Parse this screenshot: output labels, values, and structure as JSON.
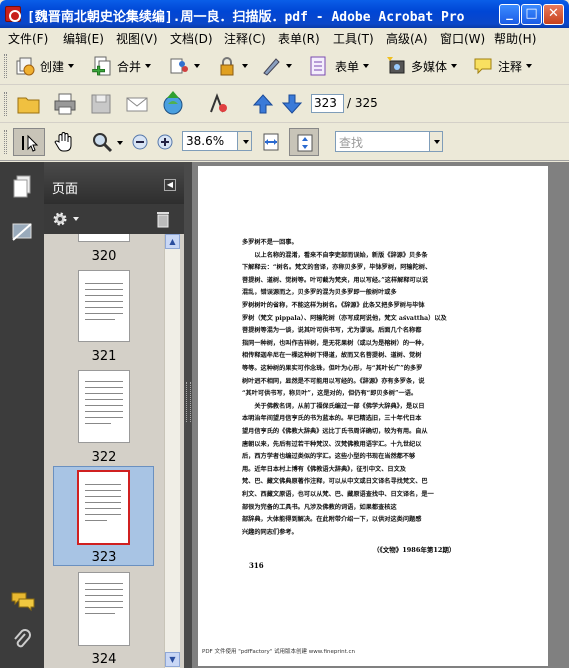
{
  "window": {
    "title": "[魏晋南北朝史论集续编].周一良．扫描版．pdf - Adobe Acrobat Pro",
    "minimize": "_",
    "maximize": "□",
    "close": "✕"
  },
  "menu": [
    "文件(F)",
    "编辑(E)",
    "视图(V)",
    "文档(D)",
    "注释(C)",
    "表单(R)",
    "工具(T)",
    "高级(A)",
    "窗口(W)",
    "帮助(H)"
  ],
  "toolbar1": {
    "create": "创建",
    "combine": "合并",
    "form": "表单",
    "multimedia": "多媒体",
    "comment": "注释"
  },
  "toolbar2": {
    "page_current": "323",
    "page_total": "/ 325"
  },
  "toolbar3": {
    "zoom": "38.6%",
    "search_placeholder": "查找"
  },
  "panel": {
    "title": "页面",
    "thumbnails": [
      "320",
      "321",
      "322",
      "323",
      "324"
    ],
    "selected": "323"
  },
  "document": {
    "lines": [
      "多罗树不是一回事。",
      "　　以上名称的混淆，看来不自李吏部而误始，新版《辞源》贝多条",
      "下解释云：“树名。梵文的音译，亦称贝多罗，毕钵罗树，阿输陀树、",
      "菩提树、道树、觉树等。叶可截为梵夹，用以写经。”这样解释可以说",
      "混乱，错误源而之，贝多罗的混为贝多罗即一般树叶或多",
      "罗树树叶的省称，不能这样为树名。《辞源》此条又把多罗树与毕钵",
      "罗树（梵文 pippala）、阿输陀树（亦写成阿说他，梵文 aśvattha）以及",
      "菩提树等混为一谈，说其叶可供书写，尤为谬误。后面几个名称都",
      "指同一种树，也叫作吉祥树，是无花果树（或以为是榕树）的一种，",
      "相传释迦牟尼在一棵这种树下得道，故而又名菩提树、道树、觉树",
      "等等。这种树的果实可作念珠，但叶为心形，与“其叶长广”的多罗",
      "树叶迥不相同，显然是不可能用以写经的。《辞源》亦有多罗条，说",
      "“其叶可供书写，称贝叶”，这是对的，但仍有“即贝多树”一语。",
      "　　关于佛教名词，从前丁福保氏编过一部《佛学大辞典》，是以日",
      "本明治年间望月信亨氏的书为蓝本的。早已精选旧，三十年代日本",
      "望月信亨氏的《佛教大辞典》远比丁氏书周详确切，较为有用。自从",
      "唐朝以来，先后有过若干种梵汉、汉梵佛教用语字汇。十九世纪以",
      "后，西方学者也编过类似的字汇。这些小型的书现在当然都不够",
      "用。近年日本村上博有《佛教语大辞典》，征引中文、日文及",
      "梵、巴、藏文佛典原著作注释，可以从中文或日文译名寻找梵文、巴",
      "利文、西藏文原语，也可以从梵、巴、藏原语查找中、日文译名，是一",
      "部很为完备的工具书。凡涉及佛教的词语，如果都查核这",
      "部辞典，大体能得到解决。在此附带介绍一下，以供对这类问题感",
      "兴趣的同志们参考。"
    ],
    "source": "（《文物》1986年第12期）",
    "page_number": "316",
    "footer": "PDF 文件使用 \"pdfFactory\" 试用版本创建 www.fineprint.cn"
  }
}
